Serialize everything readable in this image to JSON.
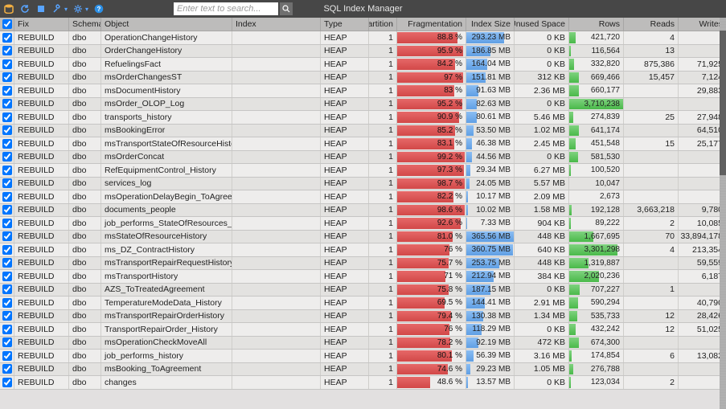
{
  "app": {
    "title": "SQL Index Manager"
  },
  "search": {
    "placeholder": "Enter text to search..."
  },
  "columns": [
    "",
    "Fix",
    "Schema",
    "Object",
    "Index",
    "Type",
    "Partition",
    "Fragmentation",
    "Index Size",
    "Unused Space",
    "Rows",
    "Reads",
    "Writes"
  ],
  "max": {
    "size_mb": 366,
    "rows": 3710238
  },
  "rows": [
    {
      "fix": "REBUILD",
      "schema": "dbo",
      "object": "OperationChangeHistory",
      "index": "",
      "type": "HEAP",
      "partition": 1,
      "frag": 88.8,
      "frag_text": "88.8 %",
      "size_mb": 293.23,
      "size_text": "293.23 MB",
      "unused": "0 KB",
      "rows": 421720,
      "rows_text": "421,720",
      "reads": "4",
      "writes": ""
    },
    {
      "fix": "REBUILD",
      "schema": "dbo",
      "object": "OrderChangeHistory",
      "index": "",
      "type": "HEAP",
      "partition": 1,
      "frag": 95.9,
      "frag_text": "95.9 %",
      "size_mb": 186.85,
      "size_text": "186.85 MB",
      "unused": "0 KB",
      "rows": 116564,
      "rows_text": "116,564",
      "reads": "13",
      "writes": ""
    },
    {
      "fix": "REBUILD",
      "schema": "dbo",
      "object": "RefuelingsFact",
      "index": "",
      "type": "HEAP",
      "partition": 1,
      "frag": 84.2,
      "frag_text": "84.2 %",
      "size_mb": 164.04,
      "size_text": "164.04 MB",
      "unused": "0 KB",
      "rows": 332820,
      "rows_text": "332,820",
      "reads": "875,386",
      "writes": "71,925"
    },
    {
      "fix": "REBUILD",
      "schema": "dbo",
      "object": "msOrderChangesST",
      "index": "",
      "type": "HEAP",
      "partition": 1,
      "frag": 97,
      "frag_text": "97 %",
      "size_mb": 151.81,
      "size_text": "151.81 MB",
      "unused": "312 KB",
      "rows": 669466,
      "rows_text": "669,466",
      "reads": "15,457",
      "writes": "7,124"
    },
    {
      "fix": "REBUILD",
      "schema": "dbo",
      "object": "msDocumentHistory",
      "index": "",
      "type": "HEAP",
      "partition": 1,
      "frag": 83,
      "frag_text": "83 %",
      "size_mb": 91.63,
      "size_text": "91.63 MB",
      "unused": "2.36 MB",
      "rows": 660177,
      "rows_text": "660,177",
      "reads": "",
      "writes": "29,883"
    },
    {
      "fix": "REBUILD",
      "schema": "dbo",
      "object": "msOrder_OLOP_Log",
      "index": "",
      "type": "HEAP",
      "partition": 1,
      "frag": 95.2,
      "frag_text": "95.2 %",
      "size_mb": 82.63,
      "size_text": "82.63 MB",
      "unused": "0 KB",
      "rows": 3710238,
      "rows_text": "3,710,238",
      "reads": "",
      "writes": ""
    },
    {
      "fix": "REBUILD",
      "schema": "dbo",
      "object": "transports_history",
      "index": "",
      "type": "HEAP",
      "partition": 1,
      "frag": 90.9,
      "frag_text": "90.9 %",
      "size_mb": 80.61,
      "size_text": "80.61 MB",
      "unused": "5.46 MB",
      "rows": 274839,
      "rows_text": "274,839",
      "reads": "25",
      "writes": "27,948"
    },
    {
      "fix": "REBUILD",
      "schema": "dbo",
      "object": "msBookingError",
      "index": "",
      "type": "HEAP",
      "partition": 1,
      "frag": 85.2,
      "frag_text": "85.2 %",
      "size_mb": 53.5,
      "size_text": "53.50 MB",
      "unused": "1.02 MB",
      "rows": 641174,
      "rows_text": "641,174",
      "reads": "",
      "writes": "64,510"
    },
    {
      "fix": "REBUILD",
      "schema": "dbo",
      "object": "msTransportStateOfResourceHistory",
      "index": "",
      "type": "HEAP",
      "partition": 1,
      "frag": 83.1,
      "frag_text": "83.1 %",
      "size_mb": 46.38,
      "size_text": "46.38 MB",
      "unused": "2.45 MB",
      "rows": 451548,
      "rows_text": "451,548",
      "reads": "15",
      "writes": "25,177"
    },
    {
      "fix": "REBUILD",
      "schema": "dbo",
      "object": "msOrderConcat",
      "index": "",
      "type": "HEAP",
      "partition": 1,
      "frag": 99.2,
      "frag_text": "99.2 %",
      "size_mb": 44.56,
      "size_text": "44.56 MB",
      "unused": "0 KB",
      "rows": 581530,
      "rows_text": "581,530",
      "reads": "",
      "writes": ""
    },
    {
      "fix": "REBUILD",
      "schema": "dbo",
      "object": "RefEquipmentControl_History",
      "index": "",
      "type": "HEAP",
      "partition": 1,
      "frag": 97.3,
      "frag_text": "97.3 %",
      "size_mb": 29.34,
      "size_text": "29.34 MB",
      "unused": "6.27 MB",
      "rows": 100520,
      "rows_text": "100,520",
      "reads": "",
      "writes": ""
    },
    {
      "fix": "REBUILD",
      "schema": "dbo",
      "object": "services_log",
      "index": "",
      "type": "HEAP",
      "partition": 1,
      "frag": 98.7,
      "frag_text": "98.7 %",
      "size_mb": 24.05,
      "size_text": "24.05 MB",
      "unused": "5.57 MB",
      "rows": 10047,
      "rows_text": "10,047",
      "reads": "",
      "writes": ""
    },
    {
      "fix": "REBUILD",
      "schema": "dbo",
      "object": "msOperationDelayBegin_ToAgreement",
      "index": "",
      "type": "HEAP",
      "partition": 1,
      "frag": 82.2,
      "frag_text": "82.2 %",
      "size_mb": 10.17,
      "size_text": "10.17 MB",
      "unused": "2.09 MB",
      "rows": 2673,
      "rows_text": "2,673",
      "reads": "",
      "writes": ""
    },
    {
      "fix": "REBUILD",
      "schema": "dbo",
      "object": "documents_people",
      "index": "",
      "type": "HEAP",
      "partition": 1,
      "frag": 98.6,
      "frag_text": "98.6 %",
      "size_mb": 10.02,
      "size_text": "10.02 MB",
      "unused": "1.58 MB",
      "rows": 192128,
      "rows_text": "192,128",
      "reads": "3,663,218",
      "writes": "9,780"
    },
    {
      "fix": "REBUILD",
      "schema": "dbo",
      "object": "job_performs_StateOfResources_history",
      "index": "",
      "type": "HEAP",
      "partition": 1,
      "frag": 92.6,
      "frag_text": "92.6 %",
      "size_mb": 7.33,
      "size_text": "7.33 MB",
      "unused": "904 KB",
      "rows": 89222,
      "rows_text": "89,222",
      "reads": "2",
      "writes": "10,085"
    },
    {
      "fix": "REBUILD",
      "schema": "dbo",
      "object": "msStateOfResourceHistory",
      "index": "",
      "type": "HEAP",
      "partition": 1,
      "frag": 81.0,
      "frag_text": "81.0 %",
      "size_mb": 365.56,
      "size_text": "365.56 MB",
      "unused": "448 KB",
      "rows": 1667695,
      "rows_text": "1,667,695",
      "reads": "70",
      "writes": "33,894,178"
    },
    {
      "fix": "REBUILD",
      "schema": "dbo",
      "object": "ms_DZ_ContractHistory",
      "index": "",
      "type": "HEAP",
      "partition": 1,
      "frag": 76,
      "frag_text": "76 %",
      "size_mb": 360.75,
      "size_text": "360.75 MB",
      "unused": "640 KB",
      "rows": 3301298,
      "rows_text": "3,301,298",
      "reads": "4",
      "writes": "213,354"
    },
    {
      "fix": "REBUILD",
      "schema": "dbo",
      "object": "msTransportRepairRequestHistory",
      "index": "",
      "type": "HEAP",
      "partition": 1,
      "frag": 75.7,
      "frag_text": "75.7 %",
      "size_mb": 253.75,
      "size_text": "253.75 MB",
      "unused": "448 KB",
      "rows": 1319887,
      "rows_text": "1,319,887",
      "reads": "",
      "writes": "59,559"
    },
    {
      "fix": "REBUILD",
      "schema": "dbo",
      "object": "msTransportHistory",
      "index": "",
      "type": "HEAP",
      "partition": 1,
      "frag": 71,
      "frag_text": "71 %",
      "size_mb": 212.94,
      "size_text": "212.94 MB",
      "unused": "384 KB",
      "rows": 2020236,
      "rows_text": "2,020,236",
      "reads": "",
      "writes": "6,187"
    },
    {
      "fix": "REBUILD",
      "schema": "dbo",
      "object": "AZS_ToTreatedAgreement",
      "index": "",
      "type": "HEAP",
      "partition": 1,
      "frag": 75.8,
      "frag_text": "75.8 %",
      "size_mb": 187.15,
      "size_text": "187.15 MB",
      "unused": "0 KB",
      "rows": 707227,
      "rows_text": "707,227",
      "reads": "1",
      "writes": ""
    },
    {
      "fix": "REBUILD",
      "schema": "dbo",
      "object": "TemperatureModeData_History",
      "index": "",
      "type": "HEAP",
      "partition": 1,
      "frag": 69.5,
      "frag_text": "69.5 %",
      "size_mb": 144.41,
      "size_text": "144.41 MB",
      "unused": "2.91 MB",
      "rows": 590294,
      "rows_text": "590,294",
      "reads": "",
      "writes": "40,790"
    },
    {
      "fix": "REBUILD",
      "schema": "dbo",
      "object": "msTransportRepairOrderHistory",
      "index": "",
      "type": "HEAP",
      "partition": 1,
      "frag": 79.4,
      "frag_text": "79.4 %",
      "size_mb": 130.38,
      "size_text": "130.38 MB",
      "unused": "1.34 MB",
      "rows": 535733,
      "rows_text": "535,733",
      "reads": "12",
      "writes": "28,426"
    },
    {
      "fix": "REBUILD",
      "schema": "dbo",
      "object": "TransportRepairOrder_History",
      "index": "",
      "type": "HEAP",
      "partition": 1,
      "frag": 76,
      "frag_text": "76 %",
      "size_mb": 118.29,
      "size_text": "118.29 MB",
      "unused": "0 KB",
      "rows": 432242,
      "rows_text": "432,242",
      "reads": "12",
      "writes": "51,025"
    },
    {
      "fix": "REBUILD",
      "schema": "dbo",
      "object": "msOperationCheckMoveAll",
      "index": "",
      "type": "HEAP",
      "partition": 1,
      "frag": 78.2,
      "frag_text": "78.2 %",
      "size_mb": 92.19,
      "size_text": "92.19 MB",
      "unused": "472 KB",
      "rows": 674300,
      "rows_text": "674,300",
      "reads": "",
      "writes": ""
    },
    {
      "fix": "REBUILD",
      "schema": "dbo",
      "object": "job_performs_history",
      "index": "",
      "type": "HEAP",
      "partition": 1,
      "frag": 80.1,
      "frag_text": "80.1 %",
      "size_mb": 56.39,
      "size_text": "56.39 MB",
      "unused": "3.16 MB",
      "rows": 174854,
      "rows_text": "174,854",
      "reads": "6",
      "writes": "13,082"
    },
    {
      "fix": "REBUILD",
      "schema": "dbo",
      "object": "msBooking_ToAgreement",
      "index": "",
      "type": "HEAP",
      "partition": 1,
      "frag": 74.6,
      "frag_text": "74.6 %",
      "size_mb": 29.23,
      "size_text": "29.23 MB",
      "unused": "1.05 MB",
      "rows": 276788,
      "rows_text": "276,788",
      "reads": "",
      "writes": ""
    },
    {
      "fix": "REBUILD",
      "schema": "dbo",
      "object": "changes",
      "index": "",
      "type": "HEAP",
      "partition": 1,
      "frag": 48.6,
      "frag_text": "48.6 %",
      "size_mb": 13.57,
      "size_text": "13.57 MB",
      "unused": "0 KB",
      "rows": 123034,
      "rows_text": "123,034",
      "reads": "2",
      "writes": ""
    }
  ]
}
